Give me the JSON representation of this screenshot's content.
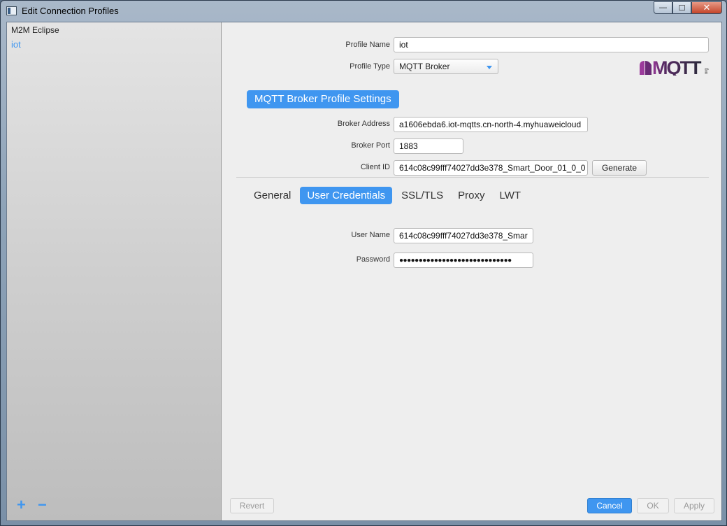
{
  "window": {
    "title": "Edit Connection Profiles",
    "minimize": "—",
    "maximize": "☐",
    "close": "✕"
  },
  "sidebar": {
    "items": [
      {
        "label": "M2M Eclipse"
      },
      {
        "label": "iot"
      }
    ],
    "add_label": "+",
    "remove_label": "−"
  },
  "profile": {
    "name_label": "Profile Name",
    "name_value": "iot",
    "type_label": "Profile Type",
    "type_value": "MQTT Broker",
    "logo_text": "MQTT",
    "logo_suffix": "org"
  },
  "broker": {
    "section_title": "MQTT Broker Profile Settings",
    "address_label": "Broker Address",
    "address_value": "a1606ebda6.iot-mqtts.cn-north-4.myhuaweicloud",
    "port_label": "Broker Port",
    "port_value": "1883",
    "client_id_label": "Client ID",
    "client_id_value": "614c08c99fff74027dd3e378_Smart_Door_01_0_0",
    "generate_label": "Generate"
  },
  "tabs": [
    {
      "label": "General",
      "active": false
    },
    {
      "label": "User Credentials",
      "active": true
    },
    {
      "label": "SSL/TLS",
      "active": false
    },
    {
      "label": "Proxy",
      "active": false
    },
    {
      "label": "LWT",
      "active": false
    }
  ],
  "credentials": {
    "username_label": "User Name",
    "username_value": "614c08c99fff74027dd3e378_Smar",
    "password_label": "Password",
    "password_value": "●●●●●●●●●●●●●●●●●●●●●●●●●●●●●"
  },
  "footer": {
    "revert_label": "Revert",
    "cancel_label": "Cancel",
    "ok_label": "OK",
    "apply_label": "Apply"
  },
  "colors": {
    "accent": "#3f96f0",
    "logo": "#7a2a7e"
  }
}
